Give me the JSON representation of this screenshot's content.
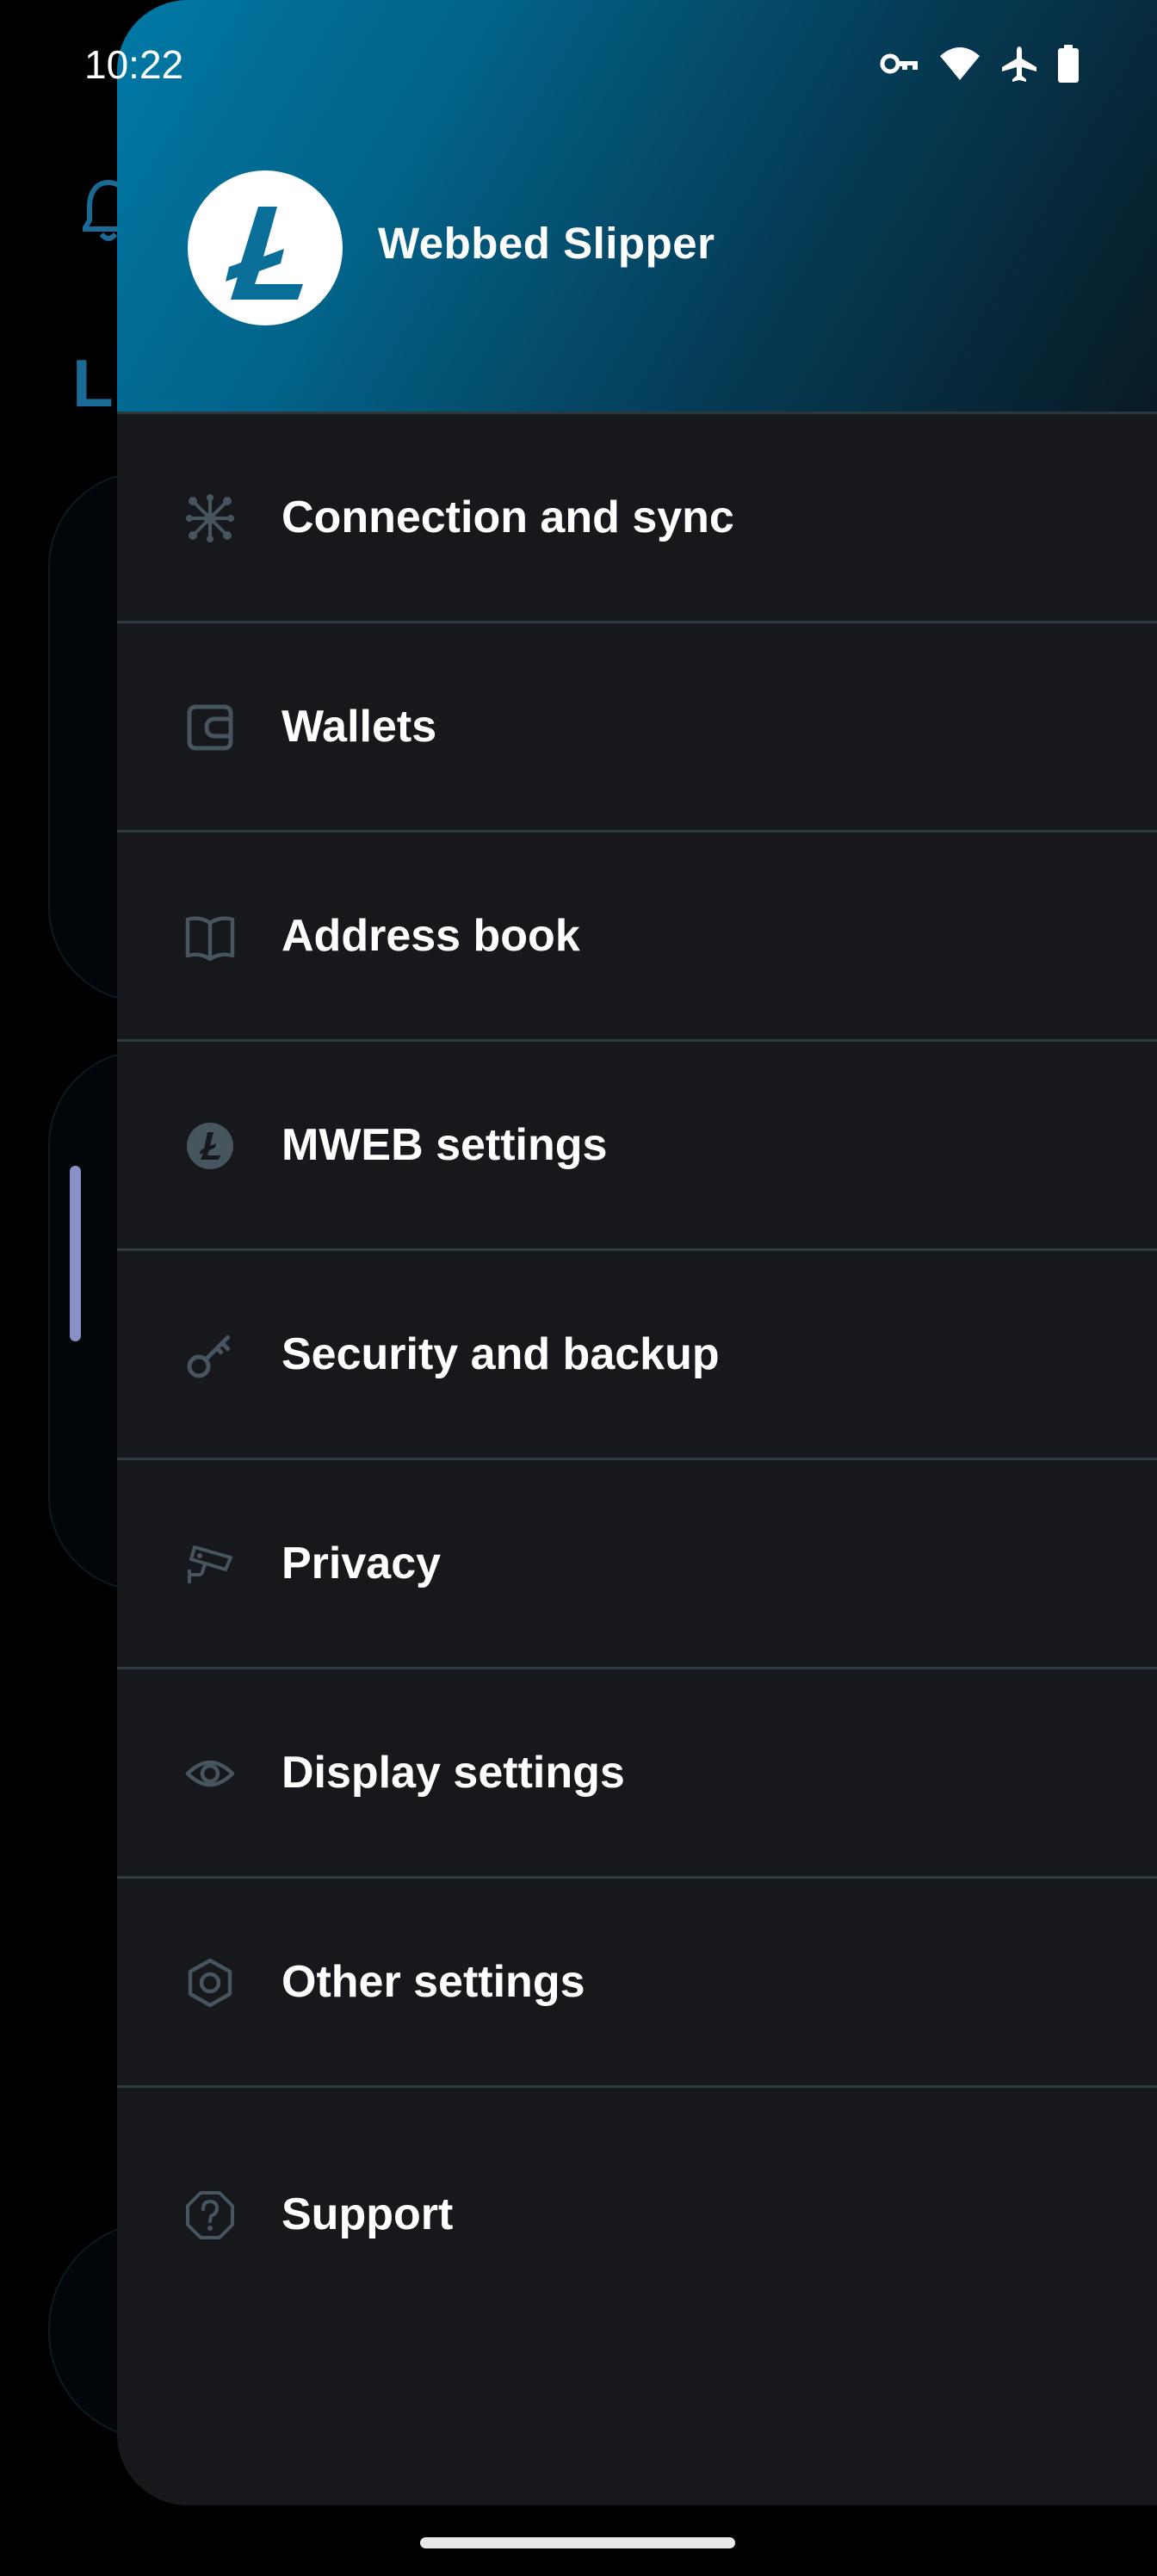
{
  "status_bar": {
    "time": "10:22",
    "icons": [
      "vpn-key-icon",
      "wifi-icon",
      "airplane-mode-icon",
      "battery-icon"
    ]
  },
  "background": {
    "title_fragment": "Li"
  },
  "drawer": {
    "header": {
      "wallet_name": "Webbed Slipper",
      "avatar_icon": "litecoin-logo-icon"
    },
    "items": [
      {
        "label": "Connection and sync",
        "icon": "network-nodes-icon"
      },
      {
        "label": "Wallets",
        "icon": "wallet-icon"
      },
      {
        "label": "Address book",
        "icon": "open-book-icon"
      },
      {
        "label": "MWEB settings",
        "icon": "litecoin-coin-icon"
      },
      {
        "label": "Security and backup",
        "icon": "key-icon"
      },
      {
        "label": "Privacy",
        "icon": "security-camera-icon"
      },
      {
        "label": "Display settings",
        "icon": "eye-icon"
      },
      {
        "label": "Other settings",
        "icon": "hexagon-settings-icon"
      },
      {
        "label": "Support",
        "icon": "help-octagon-icon"
      }
    ]
  },
  "colors": {
    "drawer_background": "#16181c",
    "header_gradient_start": "#0179a6",
    "header_gradient_end": "#081a24",
    "icon_color": "#47555e",
    "accent": "#1a6a96"
  }
}
